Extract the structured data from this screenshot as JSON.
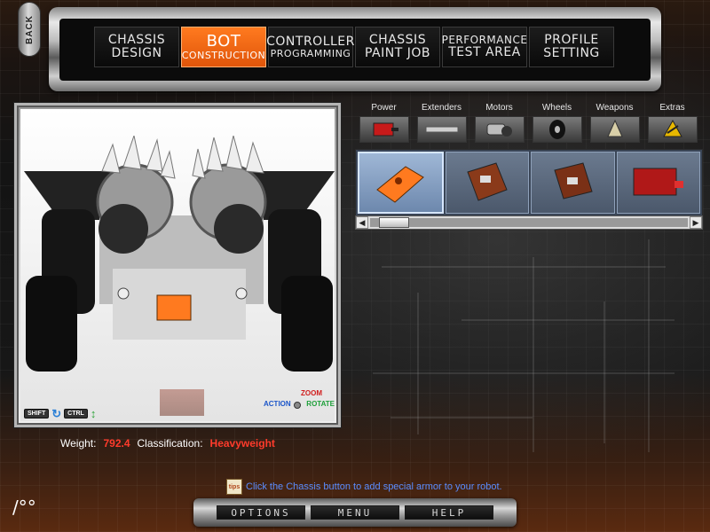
{
  "back_button": {
    "label": "BACK"
  },
  "tabs": [
    {
      "line1": "CHASSIS",
      "line2": "DESIGN",
      "active": false
    },
    {
      "line1": "BOT",
      "line2": "CONSTRUCTION",
      "active": true
    },
    {
      "line1": "CONTROLLER",
      "line2": "PROGRAMMING",
      "active": false
    },
    {
      "line1": "CHASSIS",
      "line2": "PAINT JOB",
      "active": false
    },
    {
      "line1": "PERFORMANCE",
      "line2": "TEST AREA",
      "active": false
    },
    {
      "line1": "PROFILE",
      "line2": "SETTING",
      "active": false
    }
  ],
  "categories": [
    {
      "label": "Power",
      "icon": "battery-icon"
    },
    {
      "label": "Extenders",
      "icon": "extender-bar-icon"
    },
    {
      "label": "Motors",
      "icon": "motor-icon"
    },
    {
      "label": "Wheels",
      "icon": "wheel-icon"
    },
    {
      "label": "Weapons",
      "icon": "spike-weapon-icon"
    },
    {
      "label": "Extras",
      "icon": "hazard-plate-icon"
    }
  ],
  "parts": [
    {
      "name": "orange-armor-plate",
      "selected": true
    },
    {
      "name": "circuit-board-part",
      "selected": false
    },
    {
      "name": "circuit-board-part-2",
      "selected": false
    },
    {
      "name": "red-battery-box",
      "selected": false
    }
  ],
  "scrollbar": {
    "position_fraction": 0.03
  },
  "viewport": {
    "shift_key": "SHIFT",
    "ctrl_key": "CTRL",
    "zoom_label": "ZOOM",
    "action_label": "ACTION",
    "rotate_label": "ROTATE"
  },
  "stats": {
    "weight_label": "Weight:",
    "weight_value": "792.4",
    "classification_label": "Classification:",
    "classification_value": "Heavyweight"
  },
  "tip": {
    "icon_text": "tips",
    "text": "Click the Chassis button to add special armor to your robot."
  },
  "bottom_buttons": [
    "OPTIONS",
    "MENU",
    "HELP"
  ],
  "corner_mark": "/°°",
  "colors": {
    "active_tab": "#ff6a13",
    "stat_value": "#ff3b2b",
    "tip_text": "#5a8cff"
  }
}
